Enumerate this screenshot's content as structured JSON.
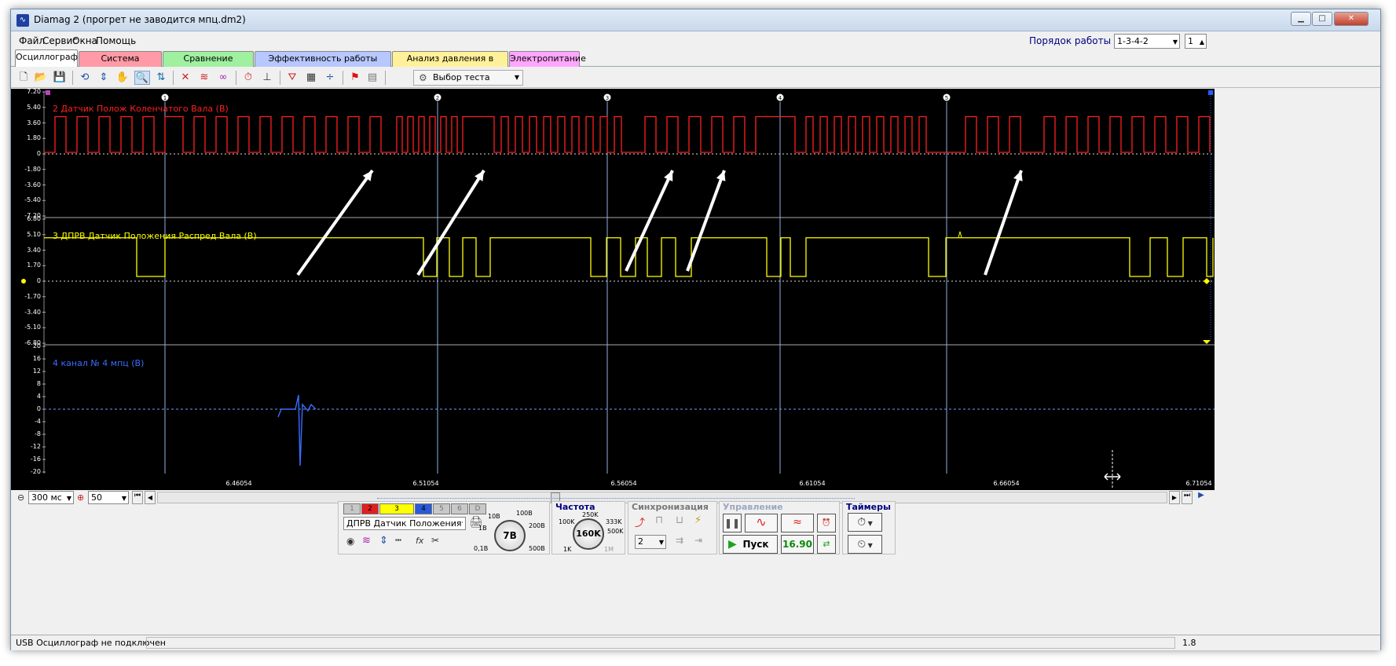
{
  "window": {
    "title": "Diamag 2 (прогрет не заводится мпц.dm2)",
    "minimize": "▁",
    "maximize": "□",
    "close": "✕"
  },
  "menu": [
    "Файл",
    "Сервис",
    "Окна",
    "Помощь"
  ],
  "cylinder_order": {
    "label": "Порядок работы цилиндров",
    "value": "1-3-4-2",
    "number": "1"
  },
  "tabs": [
    {
      "label": "Осциллограф",
      "color": "#ffffff"
    },
    {
      "label": "Система зажигания",
      "color": "#ff9aa6"
    },
    {
      "label": "Сравнение цилиндров",
      "color": "#9ff09f"
    },
    {
      "label": "Эффективность работы цилиндров",
      "color": "#b7c7ff"
    },
    {
      "label": "Анализ давления в цилиндре",
      "color": "#fff19a"
    },
    {
      "label": "Электропитание",
      "color": "#ffa6ff"
    }
  ],
  "toolbar": {
    "test_select": "Выбор теста"
  },
  "oscilloscope": {
    "markers": [
      "1",
      "2",
      "3",
      "4",
      "5"
    ],
    "ch_left_marker": "1",
    "ch_right_marker": "2",
    "channels": [
      {
        "name": "2 Датчик Полож Коленчатого Вала (В)",
        "color": "#ff2020",
        "ticks": [
          "7.20",
          "5.40",
          "3.60",
          "1.80",
          "0",
          "-1.80",
          "-3.60",
          "-5.40",
          "-7.20"
        ]
      },
      {
        "name": "3 ДПРВ Датчик Положения Распред Вала (В)",
        "color": "#ffff00",
        "ticks": [
          "6.80",
          "5.10",
          "3.40",
          "1.70",
          "0",
          "-1.70",
          "-3.40",
          "-5.10",
          "-6.80"
        ]
      },
      {
        "name": "4 канал № 4 мпц (В)",
        "color": "#3a6cff",
        "ticks": [
          "20",
          "16",
          "12",
          "8",
          "4",
          "0",
          "-4",
          "-8",
          "-12",
          "-16",
          "-20"
        ]
      }
    ],
    "time_ticks": [
      "6.46054",
      "6.51054",
      "6.56054",
      "6.61054",
      "6.66054",
      "6.71054"
    ]
  },
  "timebase": {
    "value": "300 мс",
    "scale": "50"
  },
  "channels_panel": {
    "buttons": [
      {
        "label": "1",
        "color": "#c8c8c8"
      },
      {
        "label": "2",
        "color": "#e02020"
      },
      {
        "label": "3",
        "color": "#ffff00"
      },
      {
        "label": "4",
        "color": "#2a5ad8"
      },
      {
        "label": "5",
        "color": "#c8c8c8"
      },
      {
        "label": "6",
        "color": "#c8c8c8"
      },
      {
        "label": "D",
        "color": "#c8c8c8"
      }
    ],
    "channel_name": "ДПРВ Датчик Положения Рас",
    "more": "···",
    "volt_knob": "7В",
    "volt_labels": [
      "10В",
      "100В",
      "1В",
      "200В",
      "0,1В",
      "500В"
    ]
  },
  "frequency": {
    "title": "Частота",
    "knob": "160K",
    "labels": [
      "250K",
      "100K",
      "333K",
      "500K",
      "1K",
      "1M"
    ]
  },
  "sync": {
    "title": "Синхронизация",
    "value": "2"
  },
  "control": {
    "title": "Управление",
    "start": "Пуск",
    "value": "16.90"
  },
  "timers": {
    "title": "Таймеры"
  },
  "status": {
    "text": "USB Осциллограф не подключен",
    "right": "1.8"
  }
}
